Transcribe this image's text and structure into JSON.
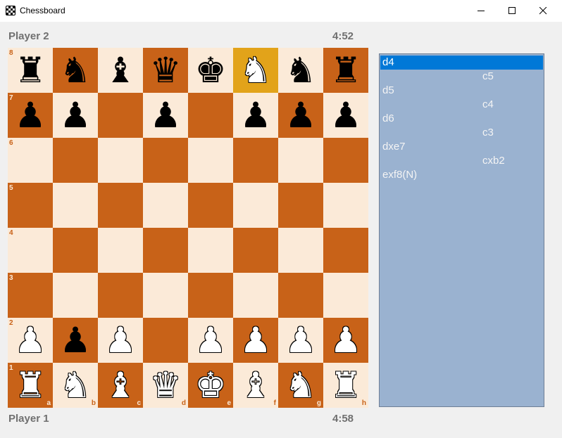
{
  "window": {
    "title": "Chessboard"
  },
  "players": {
    "top": {
      "name": "Player 2",
      "clock": "4:52"
    },
    "bottom": {
      "name": "Player 1",
      "clock": "4:58"
    }
  },
  "board": {
    "light_color": "#fbead8",
    "dark_color": "#c86218",
    "highlight_color": "#e2a31a",
    "highlight_square": "f8",
    "files": [
      "a",
      "b",
      "c",
      "d",
      "e",
      "f",
      "g",
      "h"
    ],
    "ranks": [
      "8",
      "7",
      "6",
      "5",
      "4",
      "3",
      "2",
      "1"
    ],
    "rows": [
      [
        "bR",
        "bN",
        "bB",
        "bQ",
        "bK",
        "wN",
        "bN",
        "bR"
      ],
      [
        "bP",
        "bP",
        "",
        "bP",
        "",
        "bP",
        "bP",
        "bP"
      ],
      [
        "",
        "",
        "",
        "",
        "",
        "",
        "",
        ""
      ],
      [
        "",
        "",
        "",
        "",
        "",
        "",
        "",
        ""
      ],
      [
        "",
        "",
        "",
        "",
        "",
        "",
        "",
        ""
      ],
      [
        "",
        "",
        "",
        "",
        "",
        "",
        "",
        ""
      ],
      [
        "wP",
        "bP",
        "wP",
        "",
        "wP",
        "wP",
        "wP",
        "wP"
      ],
      [
        "wR",
        "wN",
        "wB",
        "wQ",
        "wK",
        "wB",
        "wN",
        "wR"
      ]
    ]
  },
  "move_list": {
    "rows": [
      {
        "text": "d4",
        "side": "white",
        "selected": true
      },
      {
        "text": "c5",
        "side": "black",
        "selected": false
      },
      {
        "text": "d5",
        "side": "white",
        "selected": false
      },
      {
        "text": "c4",
        "side": "black",
        "selected": false
      },
      {
        "text": "d6",
        "side": "white",
        "selected": false
      },
      {
        "text": "c3",
        "side": "black",
        "selected": false
      },
      {
        "text": "dxe7",
        "side": "white",
        "selected": false
      },
      {
        "text": "cxb2",
        "side": "black",
        "selected": false
      },
      {
        "text": "exf8(N)",
        "side": "white",
        "selected": false
      }
    ]
  }
}
